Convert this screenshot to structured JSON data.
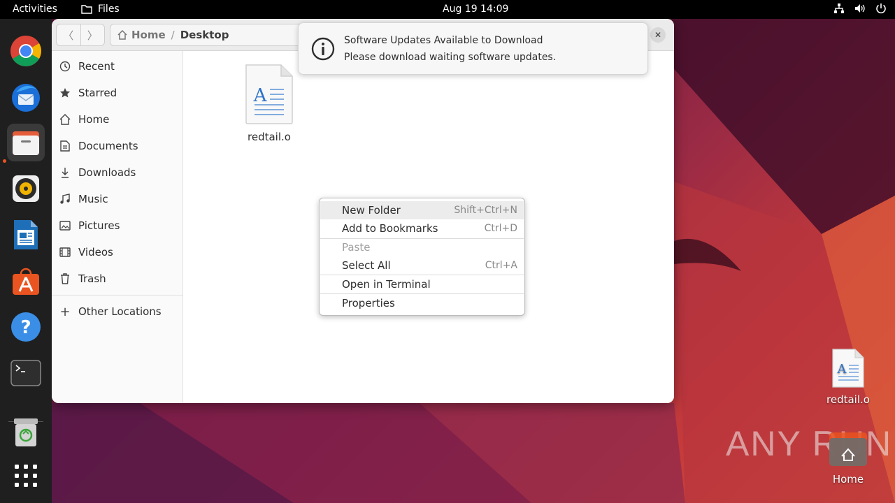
{
  "topbar": {
    "activities": "Activities",
    "app_name": "Files",
    "clock": "Aug 19  14:09",
    "tray_icons": [
      "network-icon",
      "volume-icon",
      "power-icon"
    ]
  },
  "dock": {
    "apps": [
      "chrome",
      "thunderbird",
      "files",
      "rhythmbox",
      "libreoffice-writer",
      "ubuntu-software",
      "help",
      "terminal",
      "trash",
      "show-apps"
    ],
    "active": "files",
    "accent": "#e95420"
  },
  "window": {
    "path": {
      "home": "Home",
      "separator": "/",
      "current": "Desktop"
    },
    "sidebar": {
      "items": [
        {
          "label": "Recent",
          "icon": "clock-icon"
        },
        {
          "label": "Starred",
          "icon": "star-icon"
        },
        {
          "label": "Home",
          "icon": "home-icon"
        },
        {
          "label": "Documents",
          "icon": "document-icon"
        },
        {
          "label": "Downloads",
          "icon": "download-icon"
        },
        {
          "label": "Music",
          "icon": "music-icon"
        },
        {
          "label": "Pictures",
          "icon": "picture-icon"
        },
        {
          "label": "Videos",
          "icon": "video-icon"
        },
        {
          "label": "Trash",
          "icon": "trash-icon"
        }
      ],
      "other_locations": "Other Locations"
    },
    "files": [
      {
        "name": "redtail.o",
        "icon": "text-document-icon"
      }
    ]
  },
  "context_menu": {
    "items": [
      {
        "label": "New Folder",
        "shortcut": "Shift+Ctrl+N"
      },
      {
        "label": "Add to Bookmarks",
        "shortcut": "Ctrl+D"
      },
      {
        "label": "Paste",
        "shortcut": ""
      },
      {
        "label": "Select All",
        "shortcut": "Ctrl+A"
      },
      {
        "label": "Open in Terminal",
        "shortcut": ""
      },
      {
        "label": "Properties",
        "shortcut": ""
      }
    ]
  },
  "notification": {
    "title": "Software Updates Available to Download",
    "body": "Please download waiting software updates."
  },
  "desktop": {
    "icons": [
      {
        "label": "redtail.o",
        "icon": "text-document-icon"
      },
      {
        "label": "Home",
        "icon": "home-folder-icon"
      }
    ],
    "watermark": "ANY RUN"
  }
}
